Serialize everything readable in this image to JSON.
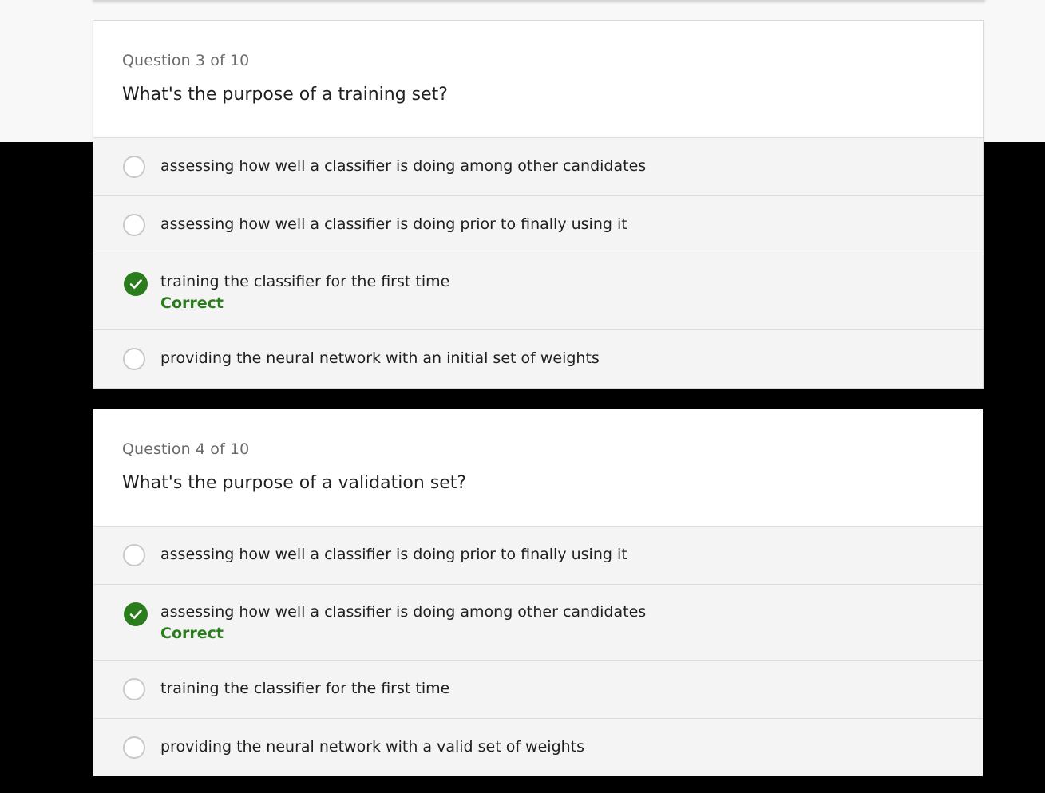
{
  "quiz": {
    "questions": [
      {
        "counter": "Question 3 of 10",
        "text": "What's the purpose of a training set?",
        "options": [
          {
            "label": "assessing how well a classifier is doing among other candidates",
            "selected": false
          },
          {
            "label": "assessing how well a classifier is doing prior to finally using it",
            "selected": false
          },
          {
            "label": "training the classifier for the first time",
            "selected": true,
            "feedback": "Correct"
          },
          {
            "label": "providing the neural network with an initial set of weights",
            "selected": false
          }
        ]
      },
      {
        "counter": "Question 4 of 10",
        "text": "What's the purpose of a validation set?",
        "options": [
          {
            "label": "assessing how well a classifier is doing prior to finally using it",
            "selected": false
          },
          {
            "label": "assessing how well a classifier is doing among other candidates",
            "selected": true,
            "feedback": "Correct"
          },
          {
            "label": "training the classifier for the first time",
            "selected": false
          },
          {
            "label": "providing the neural network with a valid set of weights",
            "selected": false
          }
        ]
      }
    ]
  },
  "colors": {
    "correct": "#2b7c1d",
    "option_bg": "#f4f4f4",
    "page_bg_top": "#f8f8f8",
    "page_bg_bottom": "#000000"
  },
  "icons": {
    "selected": "check-circle-icon",
    "unselected": "radio-circle-icon"
  }
}
